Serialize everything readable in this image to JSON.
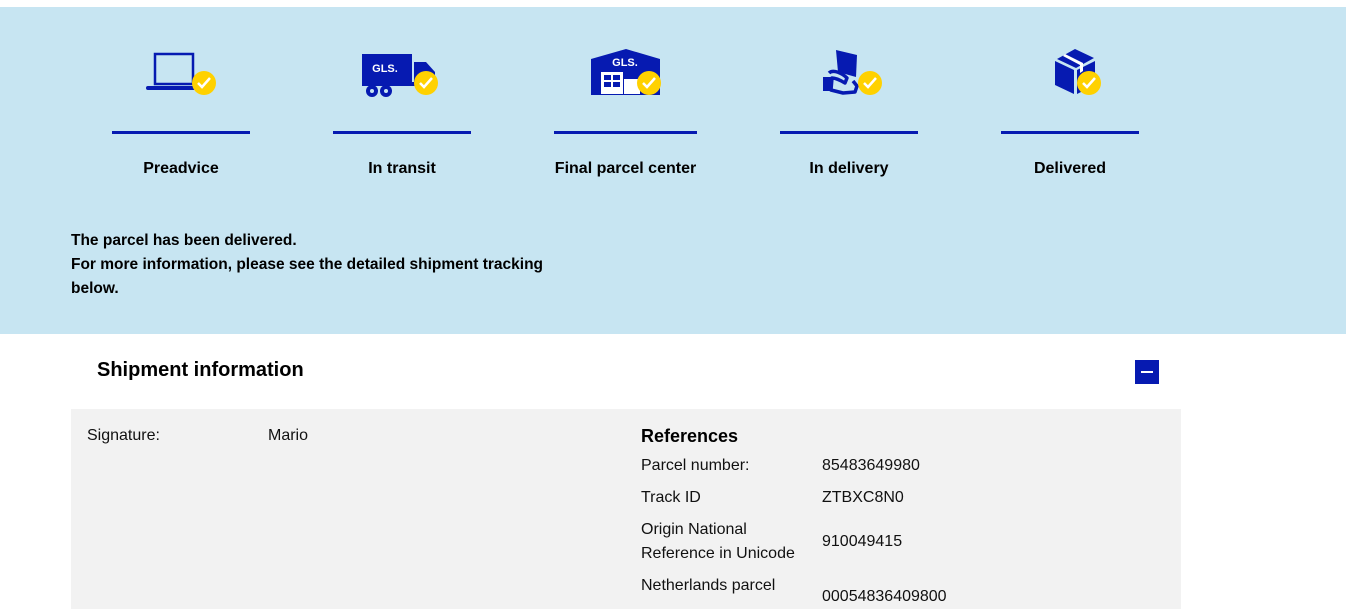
{
  "steps": [
    {
      "label": "Preadvice",
      "icon": "laptop-check-icon"
    },
    {
      "label": "In transit",
      "icon": "truck-check-icon"
    },
    {
      "label": "Final parcel center",
      "icon": "warehouse-check-icon"
    },
    {
      "label": "In delivery",
      "icon": "hand-parcel-check-icon"
    },
    {
      "label": "Delivered",
      "icon": "box-check-icon"
    }
  ],
  "brand_text": "GLS.",
  "status_message": {
    "line1": "The parcel has been delivered.",
    "line2": "For more information, please see the detailed shipment tracking",
    "line3": "below."
  },
  "shipment": {
    "title": "Shipment information",
    "signature_label": "Signature:",
    "signature_value": "Mario",
    "references_title": "References",
    "references": [
      {
        "label": "Parcel number:",
        "value": "85483649980"
      },
      {
        "label": "Track ID",
        "value": "ZTBXC8N0"
      },
      {
        "label": "Origin National Reference in Unicode",
        "value": "910049415"
      },
      {
        "label": "Netherlands parcel",
        "value": "00054836409800"
      }
    ]
  },
  "colors": {
    "hero_bg": "#c7e5f2",
    "brand_blue": "#061ab1",
    "check_yellow": "#ffd100",
    "panel_bg": "#f2f2f2"
  }
}
